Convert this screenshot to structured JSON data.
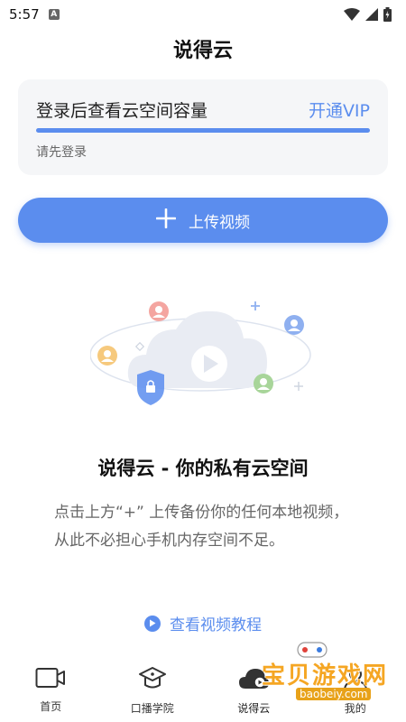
{
  "status_bar": {
    "time": "5:57",
    "notification_icon": "a-icon"
  },
  "header": {
    "title": "说得云"
  },
  "storage_card": {
    "title": "登录后查看云空间容量",
    "vip_label": "开通VIP",
    "hint": "请先登录",
    "progress": 1.0
  },
  "upload_button": {
    "label": "上传视频",
    "icon": "plus-icon"
  },
  "hero": {
    "title": "说得云 - 你的私有云空间",
    "description": "点击上方“+” 上传备份你的任何本地视频，从此不必担心手机内存空间不足。"
  },
  "tutorial_link": {
    "label": "查看视频教程",
    "icon": "play-circle-icon"
  },
  "tabs": [
    {
      "label": "首页",
      "icon": "video-camera-icon"
    },
    {
      "label": "口播学院",
      "icon": "graduation-cap-icon"
    },
    {
      "label": "说得云",
      "icon": "cloud-icon"
    },
    {
      "label": "我的",
      "icon": "user-icon"
    }
  ],
  "watermark": {
    "text": "宝贝游戏网",
    "url": "baobeiy.com"
  },
  "colors": {
    "accent": "#5b8dee",
    "card_bg": "#f5f6f8"
  }
}
